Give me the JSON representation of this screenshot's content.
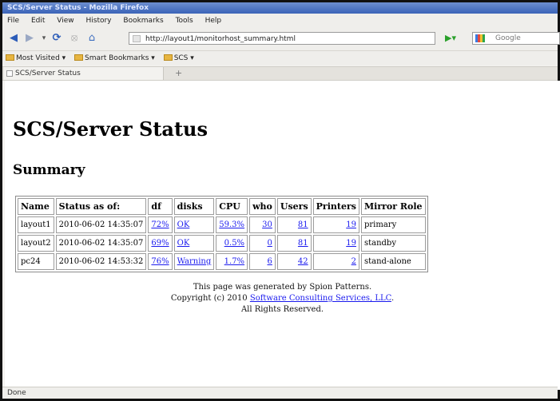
{
  "window": {
    "title": "SCS/Server Status - Mozilla Firefox"
  },
  "menu": [
    "File",
    "Edit",
    "View",
    "History",
    "Bookmarks",
    "Tools",
    "Help"
  ],
  "nav": {
    "url": "http://layout1/monitorhost_summary.html",
    "search_placeholder": "Google",
    "icons": [
      "back-icon",
      "forward-icon",
      "dropdown-icon",
      "reload-icon",
      "stop-icon",
      "home-icon",
      "go-icon",
      "search-engine-icon"
    ]
  },
  "bookmarks": [
    "Most Visited",
    "Smart Bookmarks",
    "SCS"
  ],
  "tab": {
    "label": "SCS/Server Status",
    "new_tab": "+"
  },
  "page": {
    "title": "SCS/Server Status",
    "subtitle": "Summary",
    "columns": [
      "Name",
      "Status as of:",
      "df",
      "disks",
      "CPU",
      "who",
      "Users",
      "Printers",
      "Mirror Role"
    ],
    "rows": [
      {
        "name": "layout1",
        "status": "2010-06-02 14:35:07",
        "df": "72%",
        "disks": "OK",
        "cpu": "59.3%",
        "who": "30",
        "users": "81",
        "printers": "19",
        "role": "primary"
      },
      {
        "name": "layout2",
        "status": "2010-06-02 14:35:07",
        "df": "69%",
        "disks": "OK",
        "cpu": "0.5%",
        "who": "0",
        "users": "81",
        "printers": "19",
        "role": "standby"
      },
      {
        "name": "pc24",
        "status": "2010-06-02 14:53:32",
        "df": "76%",
        "disks": "Warning",
        "cpu": "1.7%",
        "who": "6",
        "users": "42",
        "printers": "2",
        "role": "stand-alone"
      }
    ],
    "footer": {
      "line1": "This page was generated by Spion Patterns.",
      "line2_prefix": "Copyright (c) 2010",
      "line2_link": "Software Consulting Services, LLC",
      "line2_suffix": ".",
      "line3": "All Rights Reserved."
    }
  },
  "status": "Done",
  "colors": {
    "link": "#1a1aee",
    "titlebar": "#3a63b8"
  }
}
